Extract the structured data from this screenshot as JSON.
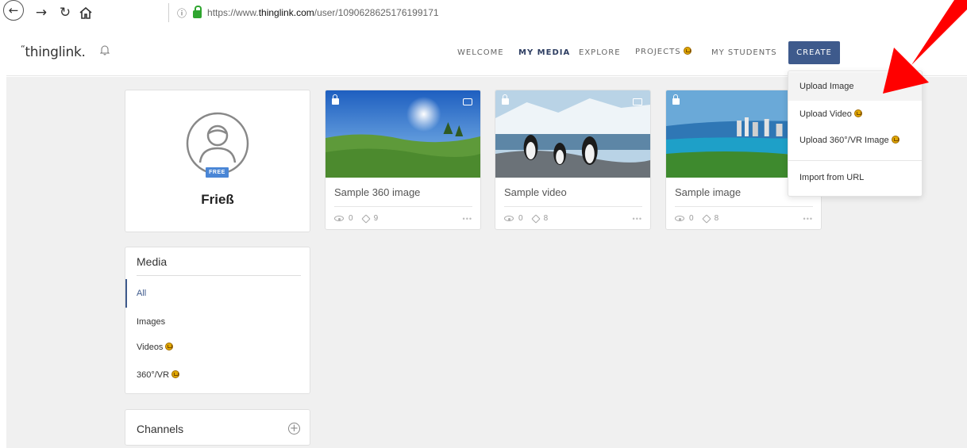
{
  "browser": {
    "url_prefix": "https://www.",
    "url_domain": "thinglink.com",
    "url_path": "/user/1090628625176199171"
  },
  "header": {
    "logo": "thinglink.",
    "nav": [
      "WELCOME",
      "MY MEDIA",
      "EXPLORE",
      "PROJECTS",
      "MY STUDENTS"
    ],
    "create_label": "CREATE"
  },
  "profile": {
    "badge": "FREE",
    "name": "Frieß"
  },
  "media_sidebar": {
    "title": "Media",
    "items": [
      "All",
      "Images",
      "Videos",
      "360°/VR"
    ]
  },
  "channels": {
    "title": "Channels"
  },
  "media_cards": [
    {
      "title": "Sample 360 image",
      "views": "0",
      "tags": "9"
    },
    {
      "title": "Sample video",
      "views": "0",
      "tags": "8"
    },
    {
      "title": "Sample image",
      "views": "0",
      "tags": "8"
    }
  ],
  "create_menu": {
    "items": [
      "Upload Image",
      "Upload Video",
      "Upload 360°/VR Image",
      "Import from URL"
    ]
  },
  "colors": {
    "accent": "#3e5a8c",
    "annotation_arrow": "#ff0000",
    "premium": "#e0a800"
  }
}
